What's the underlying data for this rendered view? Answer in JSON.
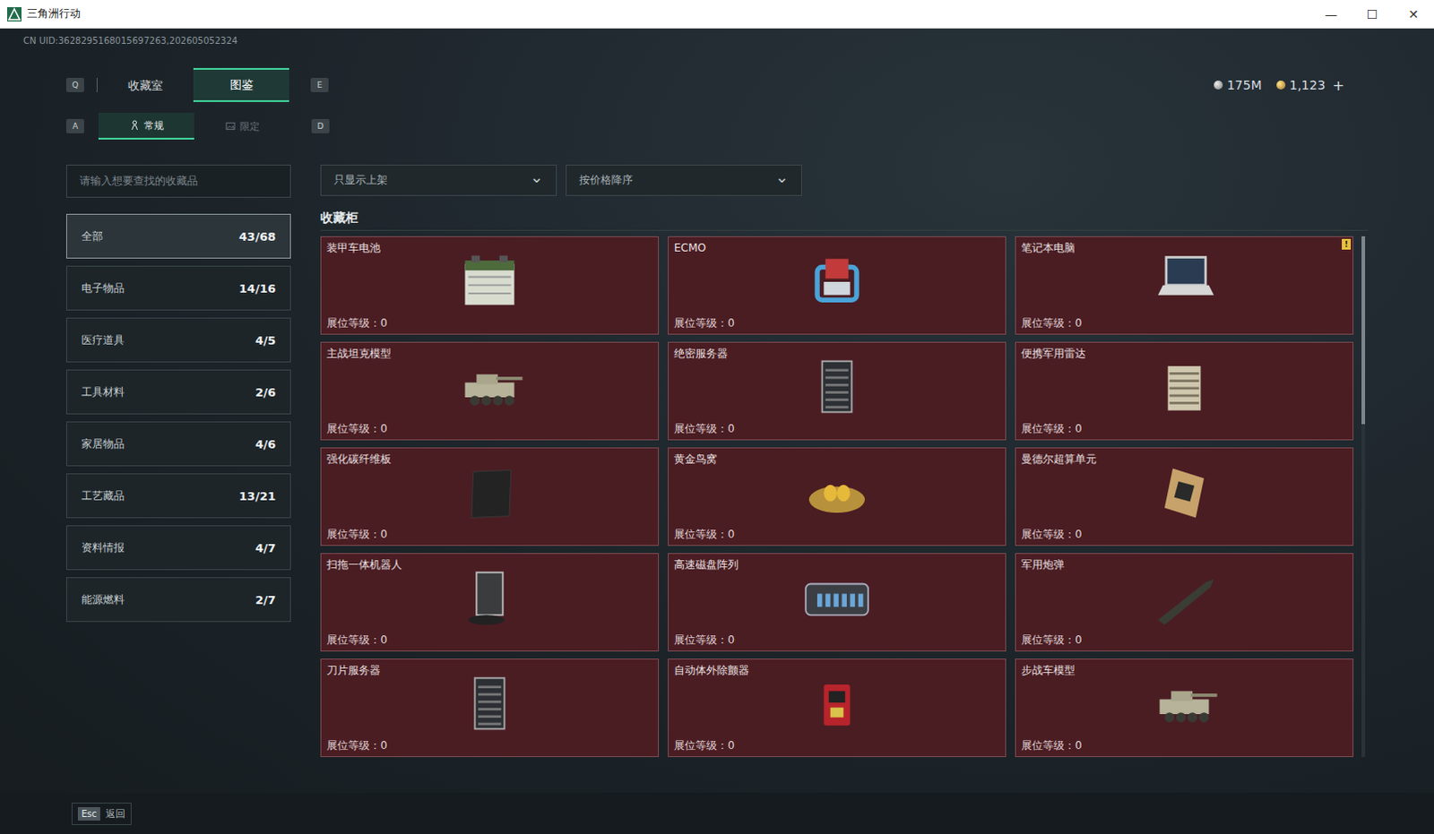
{
  "window": {
    "title": "三角洲行动",
    "controls": [
      "—",
      "☐",
      "✕"
    ]
  },
  "uid": "CN UID:3628295168015697263,202605052324",
  "currency": [
    {
      "value": "175M",
      "kind": "silver"
    },
    {
      "value": "1,123",
      "kind": "gold"
    }
  ],
  "currency_add": "+",
  "tabs": {
    "key_left": "Q",
    "key_right": "E",
    "items": [
      {
        "label": "收藏室",
        "selected": false
      },
      {
        "label": "图鉴",
        "selected": true
      }
    ]
  },
  "subtabs": {
    "key_left": "A",
    "key_right": "D",
    "items": [
      {
        "label": "常规",
        "kind": "standard",
        "selected": true
      },
      {
        "label": "限定",
        "kind": "limited",
        "selected": false
      }
    ]
  },
  "search": {
    "placeholder": "请输入想要查找的收藏品"
  },
  "filters": [
    {
      "label": "只显示上架",
      "arrow": "⌄"
    },
    {
      "label": "按价格降序",
      "arrow": "⌄"
    }
  ],
  "sidebar": {
    "items": [
      {
        "label": "全部",
        "count": "43/68",
        "selected": true
      },
      {
        "label": "电子物品",
        "count": "14/16",
        "selected": false
      },
      {
        "label": "医疗道具",
        "count": "4/5",
        "selected": false
      },
      {
        "label": "工具材料",
        "count": "2/6",
        "selected": false
      },
      {
        "label": "家居物品",
        "count": "4/6",
        "selected": false
      },
      {
        "label": "工艺藏品",
        "count": "13/21",
        "selected": false
      },
      {
        "label": "资料情报",
        "count": "4/7",
        "selected": false
      },
      {
        "label": "能源燃料",
        "count": "2/7",
        "selected": false
      }
    ]
  },
  "section_title": "收藏柜",
  "items": [
    {
      "name": "装甲车电池",
      "level": "展位等级：0",
      "kind": "battery",
      "badge": ""
    },
    {
      "name": "ECMO",
      "level": "展位等级：0",
      "kind": "ecmo",
      "badge": ""
    },
    {
      "name": "笔记本电脑",
      "level": "展位等级：0",
      "kind": "laptop",
      "badge": "!"
    },
    {
      "name": "主战坦克模型",
      "level": "展位等级：0",
      "kind": "tank",
      "badge": ""
    },
    {
      "name": "绝密服务器",
      "level": "展位等级：0",
      "kind": "server",
      "badge": ""
    },
    {
      "name": "便携军用雷达",
      "level": "展位等级：0",
      "kind": "radar",
      "badge": ""
    },
    {
      "name": "强化碳纤维板",
      "level": "展位等级：0",
      "kind": "carbon",
      "badge": ""
    },
    {
      "name": "黄金鸟窝",
      "level": "展位等级：0",
      "kind": "nest",
      "badge": ""
    },
    {
      "name": "曼德尔超算单元",
      "level": "展位等级：0",
      "kind": "chip",
      "badge": ""
    },
    {
      "name": "扫拖一体机器人",
      "level": "展位等级：0",
      "kind": "robot",
      "badge": ""
    },
    {
      "name": "高速磁盘阵列",
      "level": "展位等级：0",
      "kind": "disk",
      "badge": ""
    },
    {
      "name": "军用炮弹",
      "level": "展位等级：0",
      "kind": "shell",
      "badge": ""
    },
    {
      "name": "刀片服务器",
      "level": "展位等级：0",
      "kind": "blade",
      "badge": ""
    },
    {
      "name": "自动体外除颤器",
      "level": "展位等级：0",
      "kind": "defib",
      "badge": ""
    },
    {
      "name": "步战车模型",
      "level": "展位等级：0",
      "kind": "ifv",
      "badge": ""
    }
  ],
  "scrollbar": {
    "position": 0,
    "thumb_share": 0.36
  },
  "footer": {
    "key": "Esc",
    "label": "返回"
  }
}
